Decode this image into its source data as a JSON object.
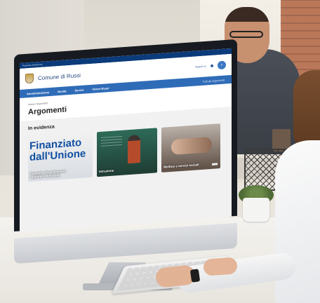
{
  "website": {
    "top_bar_label": "Provincia di Ravenna",
    "site_title": "Comune di Russi",
    "follow_label": "Seguici su",
    "nav": {
      "items": [
        "Amministrazione",
        "Novità",
        "Servizi",
        "Vivere Russi"
      ],
      "extra": "Tutti gli argomenti"
    },
    "breadcrumb": "Home / Argomenti",
    "page_title": "Argomenti",
    "section_title": "In evidenza",
    "cards": [
      {
        "big_text_line1": "Finanziato",
        "big_text_line2": "dall'Unione",
        "label": "Progetti e finanziamenti regionali ed europei"
      },
      {
        "label": "Istruzione"
      },
      {
        "label": "Welfare e servizi sociali"
      }
    ]
  },
  "colors": {
    "site_blue": "#2f6cb8",
    "top_bar": "#0b3b7a",
    "title_blue": "#2a4a7f"
  },
  "icons": [
    "crest-icon",
    "search-icon"
  ]
}
